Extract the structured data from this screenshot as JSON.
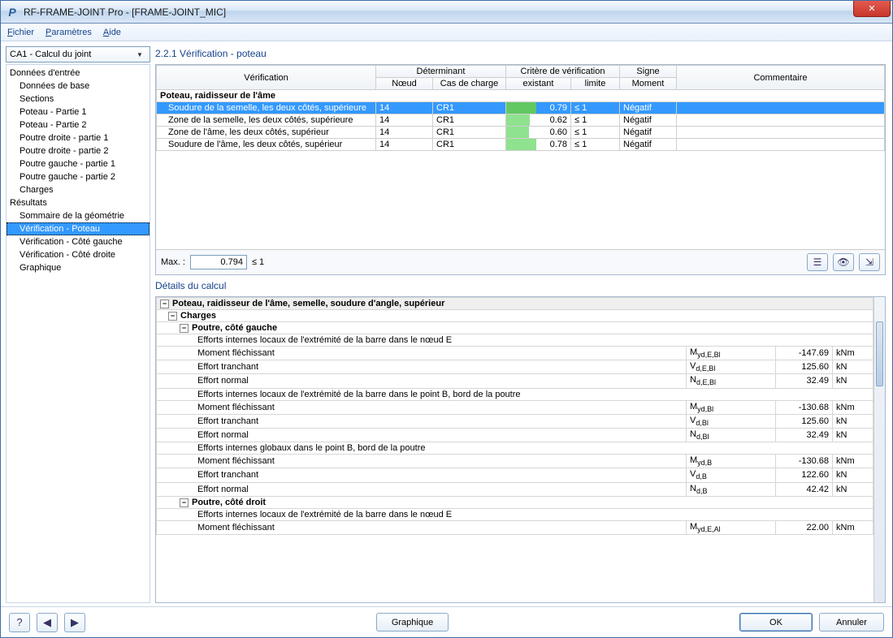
{
  "titlebar": {
    "title": "RF-FRAME-JOINT Pro - [FRAME-JOINT_MIC]"
  },
  "menu": {
    "file": "Fichier",
    "params": "Paramètres",
    "help": "Aide"
  },
  "sidebar": {
    "combo": "CA1 - Calcul du joint",
    "heading1": "Données d'entrée",
    "items1": [
      "Données de base",
      "Sections",
      "Poteau - Partie 1",
      "Poteau - Partie 2",
      "Poutre droite - partie 1",
      "Poutre droite - partie 2",
      "Poutre gauche - partie 1",
      "Poutre gauche - partie 2",
      "Charges"
    ],
    "heading2": "Résultats",
    "items2": [
      "Sommaire de la géométrie",
      "Vérification - Poteau",
      "Vérification - Côté gauche",
      "Vérification - Côté droite",
      "Graphique"
    ]
  },
  "main": {
    "title": "2.2.1 Vérification - poteau",
    "headers": {
      "verification": "Vérification",
      "determinant": "Déterminant",
      "noeud": "Nœud",
      "cas": "Cas de charge",
      "critere": "Critère de vérification",
      "existant": "existant",
      "limite": "limite",
      "signe": "Signe",
      "moment": "Moment",
      "commentaire": "Commentaire"
    },
    "group": "Poteau, raidisseur de l'âme",
    "rows": [
      {
        "v": "Soudure de la semelle, les deux côtés, supérieure",
        "n": "14",
        "c": "CR1",
        "ex": "0.79",
        "lim": "≤ 1",
        "sig": "Négatif",
        "sel": true,
        "bar": 0.79
      },
      {
        "v": "Zone de la semelle, les deux côtés, supérieure",
        "n": "14",
        "c": "CR1",
        "ex": "0.62",
        "lim": "≤ 1",
        "sig": "Négatif",
        "bar": 0.62
      },
      {
        "v": "Zone de l'âme, les deux côtés, supérieur",
        "n": "14",
        "c": "CR1",
        "ex": "0.60",
        "lim": "≤ 1",
        "sig": "Négatif",
        "bar": 0.6
      },
      {
        "v": "Soudure de l'âme, les deux côtés, supérieur",
        "n": "14",
        "c": "CR1",
        "ex": "0.78",
        "lim": "≤ 1",
        "sig": "Négatif",
        "bar": 0.78
      }
    ],
    "max_label": "Max. :",
    "max_value": "0.794",
    "max_limit": "≤ 1"
  },
  "details": {
    "title": "Détails du calcul",
    "h1": "Poteau, raidisseur de l'âme, semelle, soudure d'angle, supérieur",
    "charges": "Charges",
    "pg": "Poutre, côté gauche",
    "pd": "Poutre, côté droit",
    "l_eff_E": "Efforts internes locaux de l'extrémité de la barre dans le nœud E",
    "l_eff_B": "Efforts internes locaux de l'extrémité de la barre dans le point B, bord de la poutre",
    "g_eff_B": "Efforts internes globaux dans le point B, bord de la poutre",
    "moment": "Moment fléchissant",
    "effort_t": "Effort tranchant",
    "effort_n": "Effort normal",
    "rows_g": [
      {
        "lbl": "Moment fléchissant",
        "sym": "M yd,E,Bl",
        "val": "-147.69",
        "u": "kNm"
      },
      {
        "lbl": "Effort tranchant",
        "sym": "V d,E,Bl",
        "val": "125.60",
        "u": "kN"
      },
      {
        "lbl": "Effort normal",
        "sym": "N d,E,Bl",
        "val": "32.49",
        "u": "kN"
      }
    ],
    "rows_b": [
      {
        "lbl": "Moment fléchissant",
        "sym": "M yd,Bl",
        "val": "-130.68",
        "u": "kNm"
      },
      {
        "lbl": "Effort tranchant",
        "sym": "V d,Bl",
        "val": "125.60",
        "u": "kN"
      },
      {
        "lbl": "Effort normal",
        "sym": "N d,Bl",
        "val": "32.49",
        "u": "kN"
      }
    ],
    "rows_gb": [
      {
        "lbl": "Moment fléchissant",
        "sym": "M yd,B",
        "val": "-130.68",
        "u": "kNm"
      },
      {
        "lbl": "Effort tranchant",
        "sym": "V d,B",
        "val": "122.60",
        "u": "kN"
      },
      {
        "lbl": "Effort normal",
        "sym": "N d,B",
        "val": "42.42",
        "u": "kN"
      }
    ],
    "row_d1": {
      "lbl": "Moment fléchissant",
      "sym": "M yd,E,Al",
      "val": "22.00",
      "u": "kNm"
    }
  },
  "footer": {
    "graphique": "Graphique",
    "ok": "OK",
    "annuler": "Annuler"
  }
}
